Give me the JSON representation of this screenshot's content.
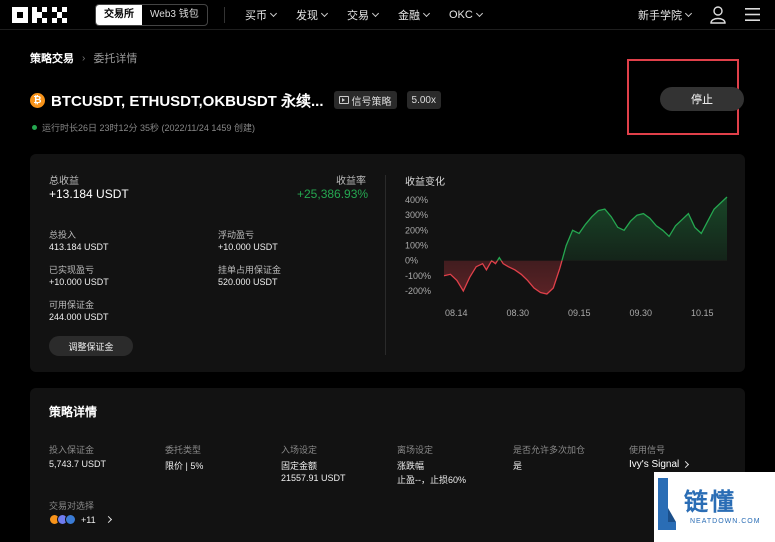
{
  "nav": {
    "toggle": [
      "交易所",
      "Web3 钱包"
    ],
    "menu": [
      "买币",
      "发现",
      "交易",
      "金融",
      "OKC"
    ],
    "academy": "新手学院"
  },
  "breadcrumb": {
    "parent": "策略交易",
    "sep": "›",
    "current": "委托详情"
  },
  "strategy": {
    "coin_symbol": "₿",
    "title": "BTCUSDT, ETHUSDT,OKBUSDT 永续...",
    "tag_signal": "信号策略",
    "tag_leverage": "5.00x",
    "runtime": "运行时长26日 23时12分 35秒 (2022/11/24 1459 创建)",
    "stop_label": "停止"
  },
  "summary": {
    "total_profit_label": "总收益",
    "total_profit": "+13.184 USDT",
    "yield_label": "收益率",
    "yield": "+25,386.93%",
    "total_investment_label": "总投入",
    "total_investment": "413.184 USDT",
    "floating_pnl_label": "浮动盈亏",
    "floating_pnl": "+10.000 USDT",
    "realized_pnl_label": "已实现盈亏",
    "realized_pnl": "+10.000 USDT",
    "order_margin_label": "挂单占用保证金",
    "order_margin": "520.000 USDT",
    "available_margin_label": "可用保证金",
    "available_margin": "244.000 USDT",
    "adjust_button": "调整保证金"
  },
  "chart_title": "收益变化",
  "chart_data": {
    "type": "line",
    "title": "收益变化",
    "y_ticks": [
      "400%",
      "300%",
      "200%",
      "100%",
      "0%",
      "-100%",
      "-200%"
    ],
    "x_ticks": [
      "08.14",
      "08.30",
      "09.15",
      "09.30",
      "10.15"
    ],
    "ylim": [
      -200,
      400
    ],
    "x": [
      0,
      0.5,
      1,
      1.5,
      2,
      2.5,
      3,
      3.3,
      3.7,
      4,
      4.3,
      4.6,
      5,
      5.5,
      6,
      6.5,
      7,
      7.5,
      8,
      8.5,
      9,
      9.5,
      10,
      10.5,
      11,
      11.5,
      12,
      12.5,
      13,
      13.5,
      14,
      14.5,
      15,
      15.5,
      16,
      16.5,
      17,
      17.5,
      18,
      18.5,
      19,
      19.5,
      20,
      20.5,
      21,
      21.5,
      22
    ],
    "y": [
      -100,
      -90,
      -130,
      -200,
      -110,
      -40,
      -20,
      -60,
      0,
      -20,
      20,
      -20,
      -40,
      -60,
      -90,
      -130,
      -180,
      -210,
      -220,
      -180,
      -50,
      100,
      200,
      180,
      240,
      290,
      330,
      340,
      290,
      220,
      200,
      260,
      300,
      310,
      280,
      230,
      200,
      160,
      230,
      270,
      310,
      220,
      180,
      260,
      340,
      380,
      420
    ],
    "neg_color": "#e0404a",
    "pos_color": "#25a750"
  },
  "details": {
    "title": "策略详情",
    "investment_margin_label": "投入保证金",
    "investment_margin": "5,743.7 USDT",
    "order_type_label": "委托类型",
    "order_type": "限价 | 5%",
    "entry_label": "入场设定",
    "entry_type": "固定金额",
    "entry_value": "21557.91 USDT",
    "exit_label": "离场设定",
    "exit_type": "涨跌幅",
    "exit_value": "止盈--，止损60%",
    "multi_entry_label": "是否允许多次加仓",
    "multi_entry": "是",
    "signal_label": "使用信号",
    "signal": "Ivy's Signal",
    "pairs_label": "交易对选择",
    "pairs_more": "+11",
    "coin_colors": [
      "#f7931a",
      "#6f7cf0",
      "#3a7bd5"
    ]
  },
  "watermark": {
    "text": "链懂",
    "sub": "NEATDOWN.COM"
  }
}
